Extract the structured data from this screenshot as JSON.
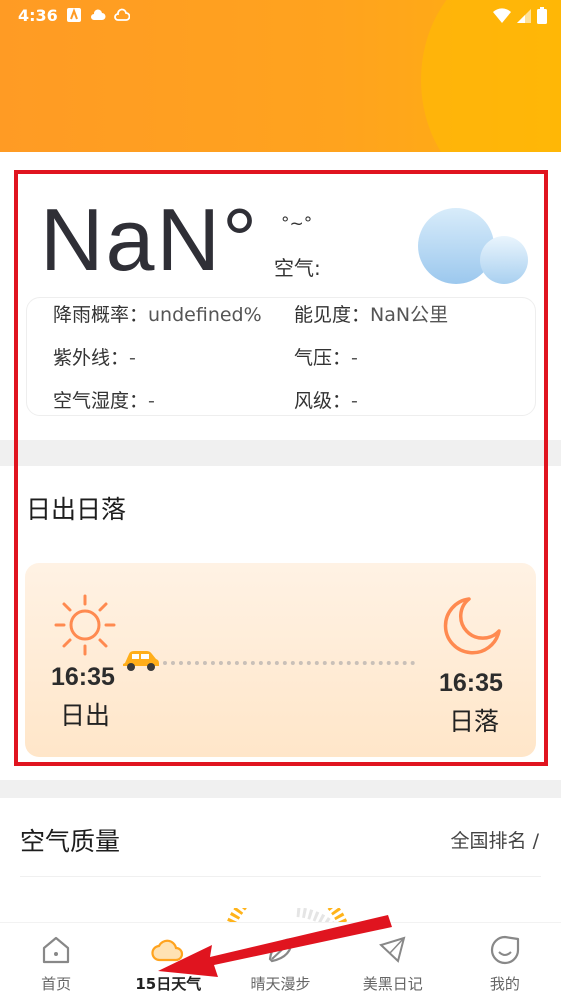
{
  "status_bar": {
    "time": "4:36"
  },
  "weather": {
    "temperature": "NaN°",
    "range": "°~°",
    "air_label": "空气:",
    "details": {
      "rain_label": "降雨概率：",
      "rain_value": "undefined%",
      "visibility_label": "能见度：",
      "visibility_value": "NaN公里",
      "uv_label": "紫外线：",
      "uv_value": "-",
      "pressure_label": "气压：",
      "pressure_value": "-",
      "humidity_label": "空气湿度：",
      "humidity_value": "-",
      "wind_label": "风级：",
      "wind_value": "-"
    }
  },
  "sun": {
    "title": "日出日落",
    "sunrise_time": "16:35",
    "sunrise_label": "日出",
    "sunset_time": "16:35",
    "sunset_label": "日落"
  },
  "air_quality": {
    "title": "空气质量",
    "rank_label": "全国排名  /"
  },
  "nav": {
    "items": [
      {
        "label": "首页",
        "icon": "home-icon"
      },
      {
        "label": "15日天气",
        "icon": "cloud-icon"
      },
      {
        "label": "晴天漫步",
        "icon": "leaf-icon"
      },
      {
        "label": "美黑日记",
        "icon": "umbrella-icon"
      },
      {
        "label": "我的",
        "icon": "profile-icon"
      }
    ]
  },
  "colors": {
    "accent": "#ff9b24",
    "highlight": "#e0141f",
    "sun": "#ff8a50"
  }
}
